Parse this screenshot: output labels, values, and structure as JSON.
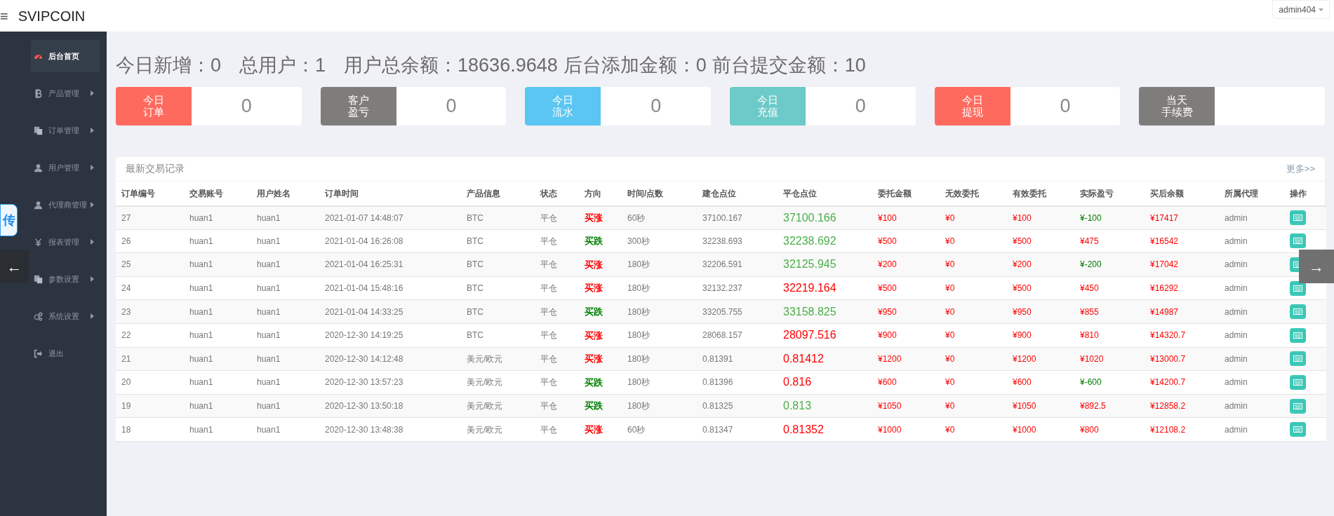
{
  "header": {
    "menu_icon": "≡",
    "brand": "SVIPCOIN",
    "user": "admin404"
  },
  "sidebar": {
    "items": [
      {
        "label": "后台首页",
        "selected": true,
        "has_children": false
      },
      {
        "label": "产品管理",
        "selected": false,
        "has_children": true
      },
      {
        "label": "订单管理",
        "selected": false,
        "has_children": true
      },
      {
        "label": "用户管理",
        "selected": false,
        "has_children": true
      },
      {
        "label": "代理商管理",
        "selected": false,
        "has_children": true
      },
      {
        "label": "报表管理",
        "selected": false,
        "has_children": true
      },
      {
        "label": "参数设置",
        "selected": false,
        "has_children": true
      },
      {
        "label": "系统设置",
        "selected": false,
        "has_children": true
      },
      {
        "label": "退出",
        "selected": false,
        "has_children": false
      }
    ]
  },
  "floating": {
    "badge": "传",
    "left_arrow": "←",
    "right_arrow": "→"
  },
  "summary": [
    "今日新增：0",
    "总用户：1",
    "用户总余额：18636.9648",
    "后台添加金额：0",
    "前台提交金额：10"
  ],
  "cards": [
    {
      "label_lines": [
        "今日",
        "订单"
      ],
      "color": "#ff6a5e",
      "value": "0"
    },
    {
      "label_lines": [
        "客户",
        "盈亏"
      ],
      "color": "#7f7d7b",
      "value": "0"
    },
    {
      "label_lines": [
        "今日",
        "流水"
      ],
      "color": "#5bc6f2",
      "value": "0"
    },
    {
      "label_lines": [
        "今日",
        "充值"
      ],
      "color": "#6ccac8",
      "value": "0"
    },
    {
      "label_lines": [
        "今日",
        "提现"
      ],
      "color": "#ff6a5e",
      "value": "0"
    },
    {
      "label_lines": [
        "当天",
        "手续费"
      ],
      "color": "#7f7d7b"
    }
  ],
  "table": {
    "title": "最新交易记录",
    "more_link": "更多>>",
    "columns": [
      "订单编号",
      "交易账号",
      "用户姓名",
      "订单时间",
      "产品信息",
      "状态",
      "方向",
      "时间/点数",
      "建仓点位",
      "平仓点位",
      "委托金额",
      "无效委托",
      "有效委托",
      "实际盈亏",
      "买后余额",
      "所属代理",
      "操作"
    ],
    "rows": [
      {
        "id": "27",
        "account": "huan1",
        "name": "huan1",
        "time": "2021-01-07 14:48:07",
        "product": "BTC",
        "status": "平仓",
        "direction": {
          "text": "买涨",
          "color": "#ff0000"
        },
        "duration": "60秒",
        "open": "37100.167",
        "close": {
          "text": "37100.166",
          "color": "#4cae4c"
        },
        "amount": "¥100",
        "invalid": "¥0",
        "valid": "¥100",
        "pnl": {
          "text": "¥-100",
          "color": "#007a00"
        },
        "balance": "¥17417",
        "agent": "admin"
      },
      {
        "id": "26",
        "account": "huan1",
        "name": "huan1",
        "time": "2021-01-04 16:26:08",
        "product": "BTC",
        "status": "平仓",
        "direction": {
          "text": "买跌",
          "color": "#008000"
        },
        "duration": "300秒",
        "open": "32238.693",
        "close": {
          "text": "32238.692",
          "color": "#4cae4c"
        },
        "amount": "¥500",
        "invalid": "¥0",
        "valid": "¥500",
        "pnl": {
          "text": "¥475",
          "color": "#ff0000"
        },
        "balance": "¥16542",
        "agent": "admin"
      },
      {
        "id": "25",
        "account": "huan1",
        "name": "huan1",
        "time": "2021-01-04 16:25:31",
        "product": "BTC",
        "status": "平仓",
        "direction": {
          "text": "买涨",
          "color": "#ff0000"
        },
        "duration": "180秒",
        "open": "32206.591",
        "close": {
          "text": "32125.945",
          "color": "#4cae4c"
        },
        "amount": "¥200",
        "invalid": "¥0",
        "valid": "¥200",
        "pnl": {
          "text": "¥-200",
          "color": "#007a00"
        },
        "balance": "¥17042",
        "agent": "admin"
      },
      {
        "id": "24",
        "account": "huan1",
        "name": "huan1",
        "time": "2021-01-04 15:48:16",
        "product": "BTC",
        "status": "平仓",
        "direction": {
          "text": "买涨",
          "color": "#ff0000"
        },
        "duration": "180秒",
        "open": "32132.237",
        "close": {
          "text": "32219.164",
          "color": "#ff0000"
        },
        "amount": "¥500",
        "invalid": "¥0",
        "valid": "¥500",
        "pnl": {
          "text": "¥450",
          "color": "#ff0000"
        },
        "balance": "¥16292",
        "agent": "admin"
      },
      {
        "id": "23",
        "account": "huan1",
        "name": "huan1",
        "time": "2021-01-04 14:33:25",
        "product": "BTC",
        "status": "平仓",
        "direction": {
          "text": "买跌",
          "color": "#008000"
        },
        "duration": "180秒",
        "open": "33205.755",
        "close": {
          "text": "33158.825",
          "color": "#4cae4c"
        },
        "amount": "¥950",
        "invalid": "¥0",
        "valid": "¥950",
        "pnl": {
          "text": "¥855",
          "color": "#ff0000"
        },
        "balance": "¥14987",
        "agent": "admin"
      },
      {
        "id": "22",
        "account": "huan1",
        "name": "huan1",
        "time": "2020-12-30 14:19:25",
        "product": "BTC",
        "status": "平仓",
        "direction": {
          "text": "买涨",
          "color": "#ff0000"
        },
        "duration": "180秒",
        "open": "28068.157",
        "close": {
          "text": "28097.516",
          "color": "#ff0000"
        },
        "amount": "¥900",
        "invalid": "¥0",
        "valid": "¥900",
        "pnl": {
          "text": "¥810",
          "color": "#ff0000"
        },
        "balance": "¥14320.7",
        "agent": "admin"
      },
      {
        "id": "21",
        "account": "huan1",
        "name": "huan1",
        "time": "2020-12-30 14:12:48",
        "product": "美元/欧元",
        "status": "平仓",
        "direction": {
          "text": "买涨",
          "color": "#ff0000"
        },
        "duration": "180秒",
        "open": "0.81391",
        "close": {
          "text": "0.81412",
          "color": "#ff0000"
        },
        "amount": "¥1200",
        "invalid": "¥0",
        "valid": "¥1200",
        "pnl": {
          "text": "¥1020",
          "color": "#ff0000"
        },
        "balance": "¥13000.7",
        "agent": "admin"
      },
      {
        "id": "20",
        "account": "huan1",
        "name": "huan1",
        "time": "2020-12-30 13:57:23",
        "product": "美元/欧元",
        "status": "平仓",
        "direction": {
          "text": "买跌",
          "color": "#008000"
        },
        "duration": "180秒",
        "open": "0.81396",
        "close": {
          "text": "0.816",
          "color": "#ff0000"
        },
        "amount": "¥600",
        "invalid": "¥0",
        "valid": "¥600",
        "pnl": {
          "text": "¥-600",
          "color": "#007a00"
        },
        "balance": "¥14200.7",
        "agent": "admin"
      },
      {
        "id": "19",
        "account": "huan1",
        "name": "huan1",
        "time": "2020-12-30 13:50:18",
        "product": "美元/欧元",
        "status": "平仓",
        "direction": {
          "text": "买跌",
          "color": "#008000"
        },
        "duration": "180秒",
        "open": "0.81325",
        "close": {
          "text": "0.813",
          "color": "#4cae4c"
        },
        "amount": "¥1050",
        "invalid": "¥0",
        "valid": "¥1050",
        "pnl": {
          "text": "¥892.5",
          "color": "#ff0000"
        },
        "balance": "¥12858.2",
        "agent": "admin"
      },
      {
        "id": "18",
        "account": "huan1",
        "name": "huan1",
        "time": "2020-12-30 13:48:38",
        "product": "美元/欧元",
        "status": "平仓",
        "direction": {
          "text": "买涨",
          "color": "#ff0000"
        },
        "duration": "60秒",
        "open": "0.81347",
        "close": {
          "text": "0.81352",
          "color": "#ff0000"
        },
        "amount": "¥1000",
        "invalid": "¥0",
        "valid": "¥1000",
        "pnl": {
          "text": "¥800",
          "color": "#ff0000"
        },
        "balance": "¥12108.2",
        "agent": "admin"
      }
    ]
  }
}
